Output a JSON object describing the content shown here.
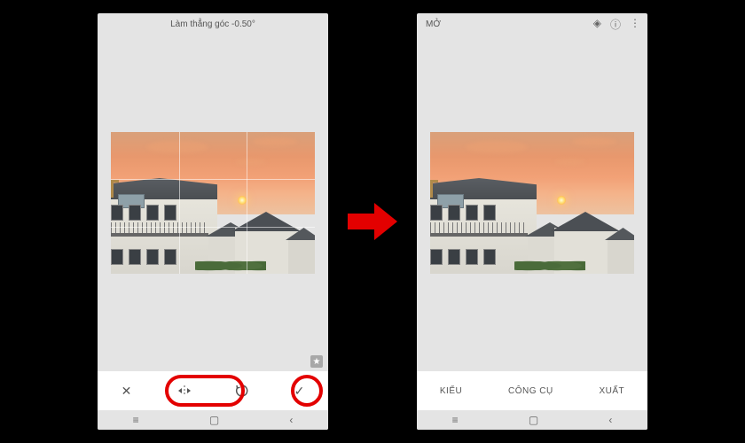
{
  "left_phone": {
    "header_text": "Làm thẳng góc -0.50°",
    "buttons": {
      "cancel": "✕",
      "flip": "⇋",
      "rotate": "↻",
      "confirm": "✓"
    },
    "nav": {
      "back": "≡",
      "home": "▢",
      "recent": "‹"
    }
  },
  "right_phone": {
    "header_text": "MỞ",
    "top_icons": {
      "layers": "◈",
      "info": "ⓘ",
      "menu": "⋮"
    },
    "buttons": {
      "styles": "KIỂU",
      "tools": "CÔNG CỤ",
      "export": "XUẤT"
    },
    "nav": {
      "back": "≡",
      "home": "▢",
      "recent": "‹"
    }
  },
  "annotations": {
    "arrow_color": "#e30000"
  }
}
